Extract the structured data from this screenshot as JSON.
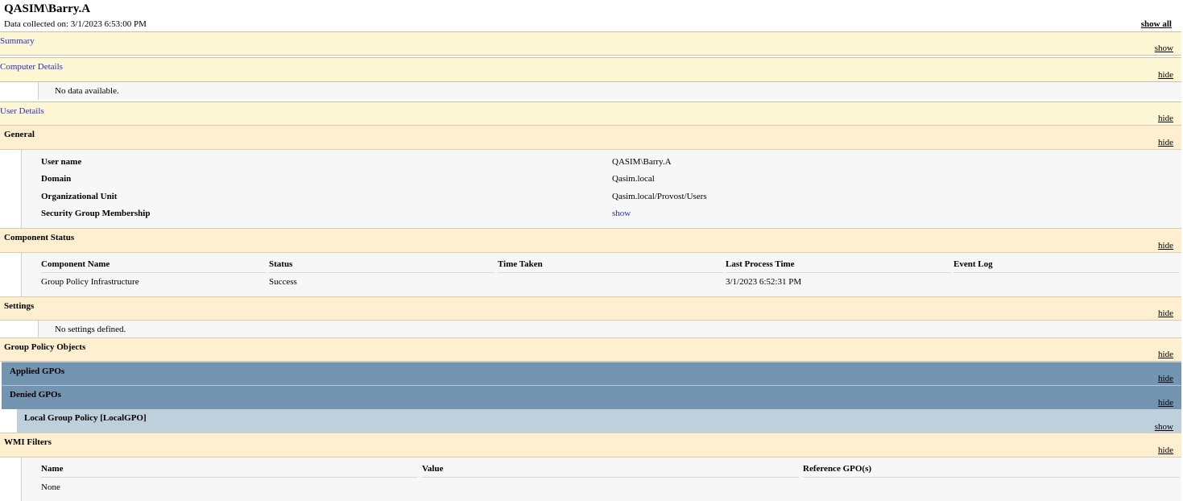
{
  "header": {
    "title": "QASIM\\Barry.A",
    "collected": "Data collected on: 3/1/2023 6:53:00 PM",
    "show_all": "show all"
  },
  "summary": {
    "label": "Summary",
    "toggle": "show"
  },
  "computer_details": {
    "label": "Computer Details",
    "toggle": "hide",
    "no_data": "No data available."
  },
  "user_details": {
    "label": "User Details",
    "toggle": "hide"
  },
  "general": {
    "label": "General",
    "toggle": "hide",
    "rows": [
      {
        "key": "User name",
        "value": "QASIM\\Barry.A"
      },
      {
        "key": "Domain",
        "value": "Qasim.local"
      },
      {
        "key": "Organizational Unit",
        "value": "Qasim.local/Provost/Users"
      },
      {
        "key": "Security Group Membership",
        "value": "show"
      }
    ]
  },
  "component_status": {
    "label": "Component Status",
    "toggle": "hide",
    "headers": [
      "Component Name",
      "Status",
      "Time Taken",
      "Last Process Time",
      "Event Log"
    ],
    "rows": [
      [
        "Group Policy Infrastructure",
        "Success",
        "",
        "3/1/2023 6:52:31 PM",
        ""
      ]
    ]
  },
  "settings": {
    "label": "Settings",
    "toggle": "hide",
    "no_data": "No settings defined."
  },
  "gpo": {
    "label": "Group Policy Objects",
    "toggle": "hide"
  },
  "applied": {
    "label": "Applied GPOs",
    "toggle": "hide"
  },
  "denied": {
    "label": "Denied GPOs",
    "toggle": "hide"
  },
  "local_gpo": {
    "label": "Local Group Policy [LocalGPO]",
    "toggle": "show"
  },
  "wmi": {
    "label": "WMI Filters",
    "toggle": "hide",
    "headers": [
      "Name",
      "Value",
      "Reference GPO(s)"
    ],
    "rows": [
      [
        "None",
        "",
        ""
      ]
    ]
  },
  "colors": {
    "section_yellow": "#fef7d6",
    "section_orange": "#feefd0",
    "gpo_blue": "#7395b2",
    "gpo_lightblue": "#bed0dc",
    "link": "#2b2fb5"
  }
}
